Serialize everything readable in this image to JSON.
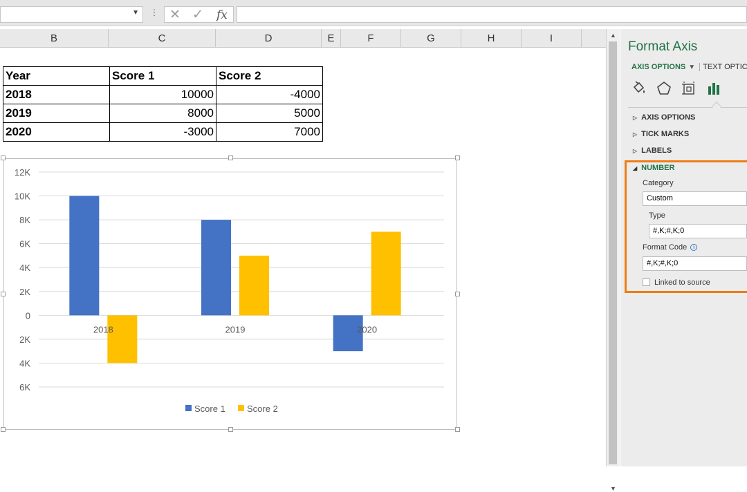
{
  "formula_bar": {
    "name_box": "",
    "dots": "⋮",
    "cancel_symbol": "✕",
    "enter_symbol": "✓",
    "fx_label": "fx",
    "formula": ""
  },
  "columns": [
    "B",
    "C",
    "D",
    "E",
    "F",
    "G",
    "H",
    "I"
  ],
  "table": {
    "header": [
      "Year",
      "Score 1",
      "Score 2"
    ],
    "rows": [
      [
        "2018",
        "10000",
        "-4000"
      ],
      [
        "2019",
        "8000",
        "5000"
      ],
      [
        "2020",
        "-3000",
        "7000"
      ]
    ]
  },
  "chart_data": {
    "type": "bar",
    "categories": [
      "2018",
      "2019",
      "2020"
    ],
    "series": [
      {
        "name": "Score 1",
        "color": "#4472c4",
        "values": [
          10000,
          8000,
          -3000
        ]
      },
      {
        "name": "Score 2",
        "color": "#ffc000",
        "values": [
          -4000,
          5000,
          7000
        ]
      }
    ],
    "ylim": [
      -6000,
      12000
    ],
    "yticks": [
      12000,
      10000,
      8000,
      6000,
      4000,
      2000,
      0,
      -2000,
      -4000,
      -6000
    ],
    "ytick_labels": [
      "12K",
      "10K",
      "8K",
      "6K",
      "4K",
      "2K",
      "0",
      "2K",
      "4K",
      "6K"
    ],
    "number_format": "#,K;#,K;0",
    "grid": true,
    "legend": "bottom",
    "title": "",
    "xlabel": "",
    "ylabel": ""
  },
  "pane": {
    "title": "Format Axis",
    "tab_active": "AXIS OPTIONS",
    "tab_other": "TEXT OPTIC",
    "sections": {
      "axis_options": "AXIS OPTIONS",
      "tick_marks": "TICK MARKS",
      "labels": "LABELS",
      "number": "NUMBER"
    },
    "category_label": "Category",
    "category_value": "Custom",
    "type_label": "Type",
    "type_value": "#,K;#,K;0",
    "format_code_label": "Format Code",
    "format_code_value": "#,K;#,K;0",
    "linked_label": "Linked to source",
    "linked_checked": false,
    "accent": "#217346",
    "highlight": "#f07c14"
  }
}
